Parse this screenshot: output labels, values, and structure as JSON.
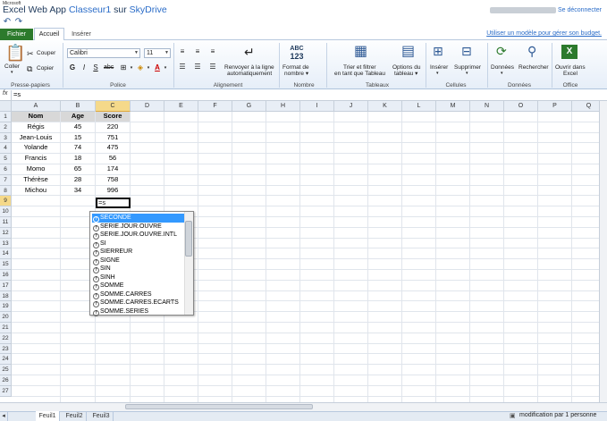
{
  "app": {
    "brand_small": "Microsoft",
    "app_name": "Excel Web App",
    "doc_name": "Classeur1",
    "on_word": "sur",
    "service": "SkyDrive",
    "signout": "Se déconnecter"
  },
  "tabs": {
    "file": "Fichier",
    "home": "Accueil",
    "insert": "Insérer",
    "template_link": "Utiliser un modèle pour gérer son budget."
  },
  "ribbon": {
    "clipboard": {
      "paste": "Coller",
      "cut": "Couper",
      "copy": "Copier",
      "label": "Presse-papiers"
    },
    "font": {
      "name": "Calibri",
      "size": "11",
      "label": "Police"
    },
    "alignment": {
      "wrap_line1": "Renvoyer à la ligne",
      "wrap_line2": "automatiquement",
      "label": "Alignement"
    },
    "number": {
      "format_line1": "Format de",
      "format_line2": "nombre",
      "icon_text": "ABC\n123",
      "label": "Nombre"
    },
    "tables": {
      "sort_line1": "Trier et filtrer",
      "sort_line2": "en tant que Tableau",
      "options_line1": "Options du",
      "options_line2": "tableau",
      "label": "Tableaux"
    },
    "cells": {
      "insert": "Insérer",
      "delete": "Supprimer",
      "label": "Cellules"
    },
    "data": {
      "data": "Données",
      "find": "Rechercher",
      "label": "Données"
    },
    "office": {
      "open_line1": "Ouvrir dans",
      "open_line2": "Excel",
      "label": "Office"
    }
  },
  "formula_bar": {
    "fx": "fx",
    "value": "=s"
  },
  "grid": {
    "columns": [
      "A",
      "B",
      "C",
      "D",
      "E",
      "F",
      "G",
      "H",
      "I",
      "J",
      "K",
      "L",
      "M",
      "N",
      "O",
      "P",
      "Q"
    ],
    "rows": [
      "1",
      "2",
      "3",
      "4",
      "5",
      "6",
      "7",
      "8",
      "9",
      "10",
      "11",
      "12",
      "13",
      "14",
      "15",
      "16",
      "17",
      "18",
      "19",
      "20",
      "21",
      "22",
      "23",
      "24",
      "25",
      "26",
      "27"
    ],
    "headers": [
      "Nom",
      "Age",
      "Score"
    ],
    "data": [
      [
        "Régis",
        "45",
        "220"
      ],
      [
        "Jean-Louis",
        "15",
        "751"
      ],
      [
        "Yolande",
        "74",
        "475"
      ],
      [
        "Francis",
        "18",
        "56"
      ],
      [
        "Momo",
        "65",
        "174"
      ],
      [
        "Thérèse",
        "28",
        "758"
      ],
      [
        "Michou",
        "34",
        "996"
      ]
    ],
    "active_cell": "=s"
  },
  "autocomplete": {
    "items": [
      "SECONDE",
      "SERIE.JOUR.OUVRE",
      "SERIE.JOUR.OUVRE.INTL",
      "SI",
      "SIERREUR",
      "SIGNE",
      "SIN",
      "SINH",
      "SOMME",
      "SOMME.CARRES",
      "SOMME.CARRES.ECARTS",
      "SOMME.SERIES"
    ],
    "selected_index": 0
  },
  "sheets": [
    "Feuil1",
    "Feuil2",
    "Feuil3"
  ],
  "status": {
    "text": "modification par 1 personne"
  }
}
